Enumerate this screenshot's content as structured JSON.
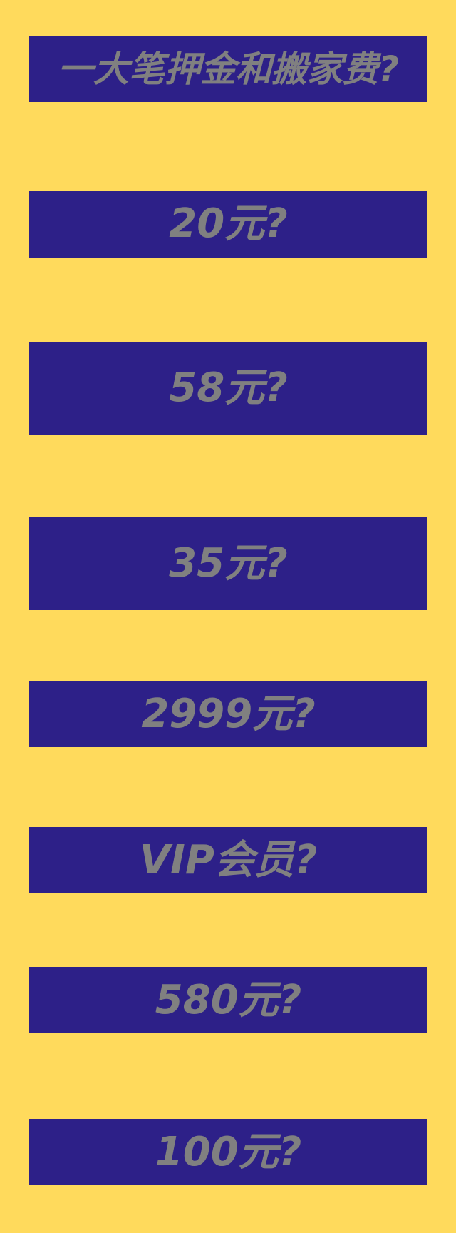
{
  "colors": {
    "background": "#FFDA5C",
    "banner": "#2D2088",
    "text": "#808080"
  },
  "banners": [
    {
      "text": "一大笔押金和搬家费?"
    },
    {
      "text": "20元?"
    },
    {
      "text": "58元?"
    },
    {
      "text": "35元?"
    },
    {
      "text": "2999元?"
    },
    {
      "text": "VIP会员?"
    },
    {
      "text": "580元?"
    },
    {
      "text": "100元?"
    }
  ]
}
